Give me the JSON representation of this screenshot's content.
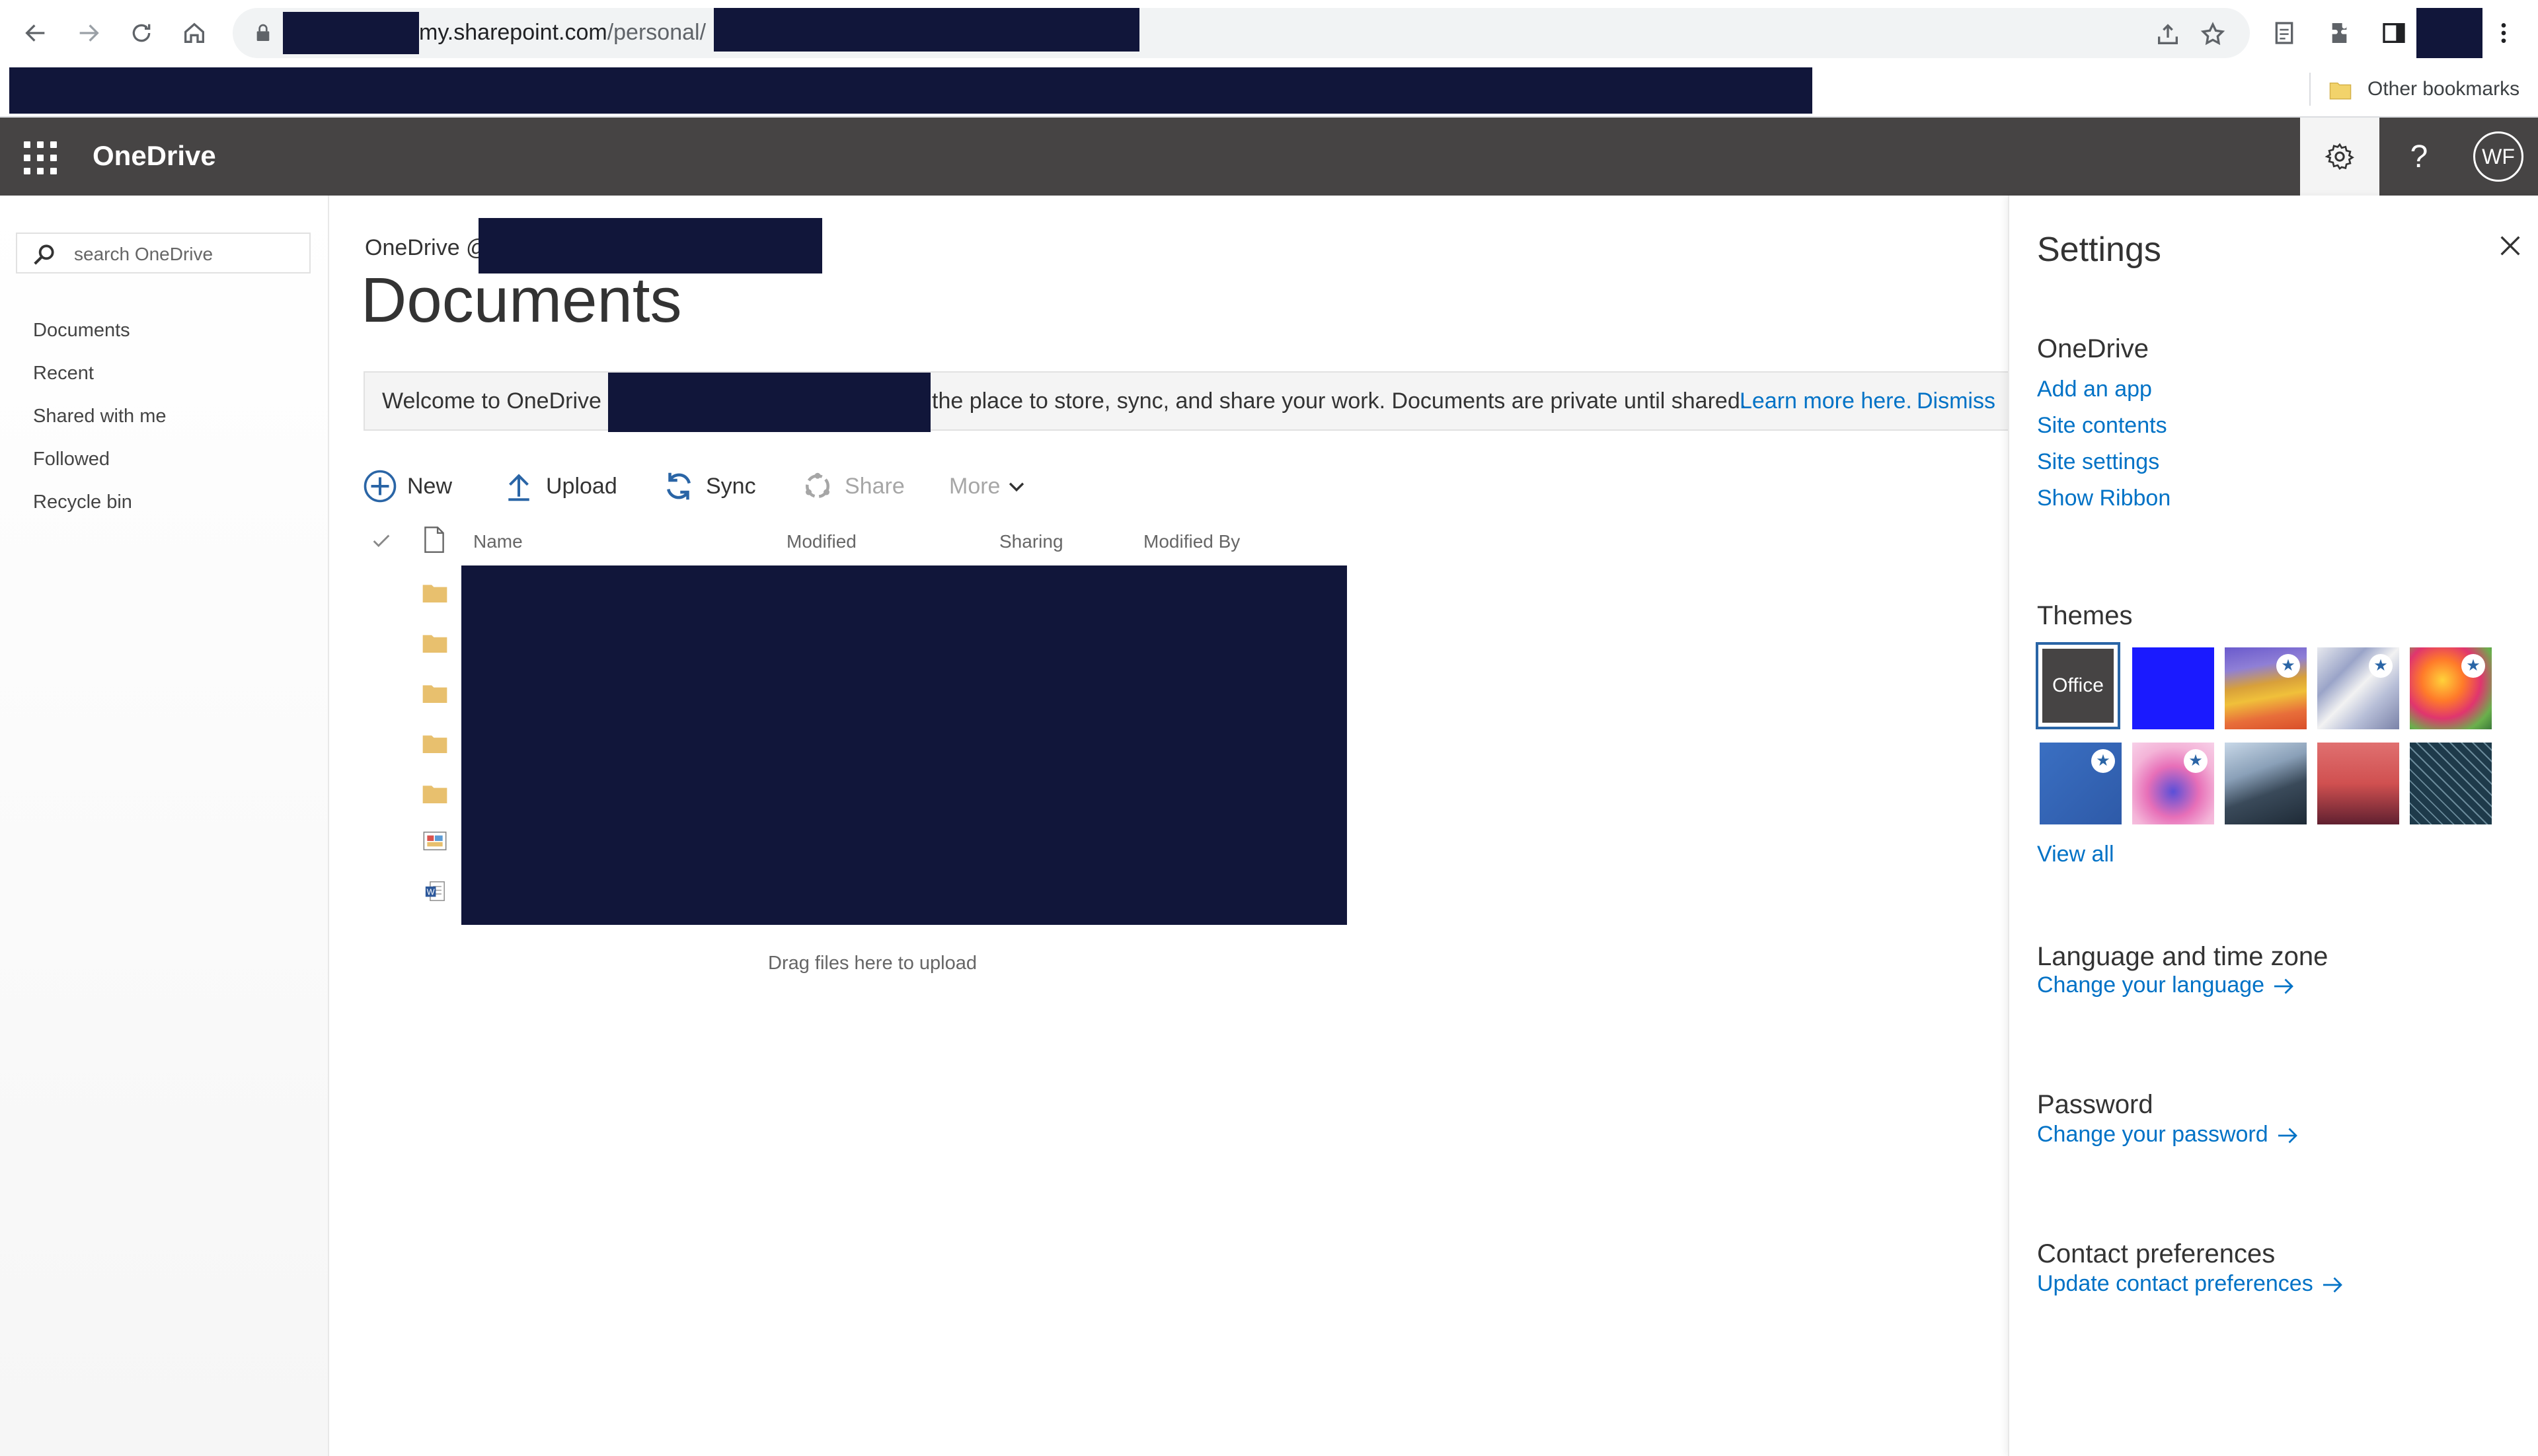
{
  "browser": {
    "url_domain": "my.sharepoint.com",
    "url_path": "/personal/",
    "bookmarks": {
      "other_bookmarks": "Other bookmarks"
    }
  },
  "suite_bar": {
    "app_name": "OneDrive",
    "user_initials": "WF",
    "help_glyph": "?"
  },
  "left_nav": {
    "search_placeholder": "search OneDrive",
    "items": [
      {
        "label": "Documents"
      },
      {
        "label": "Recent"
      },
      {
        "label": "Shared with me"
      },
      {
        "label": "Followed"
      },
      {
        "label": "Recycle bin"
      }
    ]
  },
  "main": {
    "breadcrumb": "OneDrive @",
    "title": "Documents",
    "banner": {
      "prefix": "Welcome to OneDrive @",
      "message": "the place to store, sync, and share your work. Documents are private until shared.",
      "learn_more": "Learn more here.",
      "dismiss": "Dismiss"
    },
    "commands": {
      "new": "New",
      "upload": "Upload",
      "sync": "Sync",
      "share": "Share",
      "more": "More"
    },
    "columns": {
      "name": "Name",
      "modified": "Modified",
      "sharing": "Sharing",
      "modified_by": "Modified By"
    },
    "file_rows": [
      {
        "type": "folder-icon"
      },
      {
        "type": "folder-icon"
      },
      {
        "type": "folder-icon"
      },
      {
        "type": "folder-icon"
      },
      {
        "type": "folder-icon"
      },
      {
        "type": "image-file-icon"
      },
      {
        "type": "word-document-icon"
      }
    ],
    "drag_hint": "Drag files here to upload"
  },
  "settings": {
    "title": "Settings",
    "onedrive": {
      "heading": "OneDrive",
      "links": [
        "Add an app",
        "Site contents",
        "Site settings",
        "Show Ribbon"
      ]
    },
    "themes": {
      "heading": "Themes",
      "office_label": "Office",
      "view_all": "View all",
      "selected": "Office"
    },
    "language": {
      "heading": "Language and time zone",
      "link": "Change your language"
    },
    "password": {
      "heading": "Password",
      "link": "Change your password"
    },
    "contact": {
      "heading": "Contact preferences",
      "link": "Update contact preferences"
    }
  },
  "colors": {
    "suite_bar": "#464444",
    "link": "#0072c6",
    "redaction": "#11163a",
    "folder": "#e8c06e"
  }
}
